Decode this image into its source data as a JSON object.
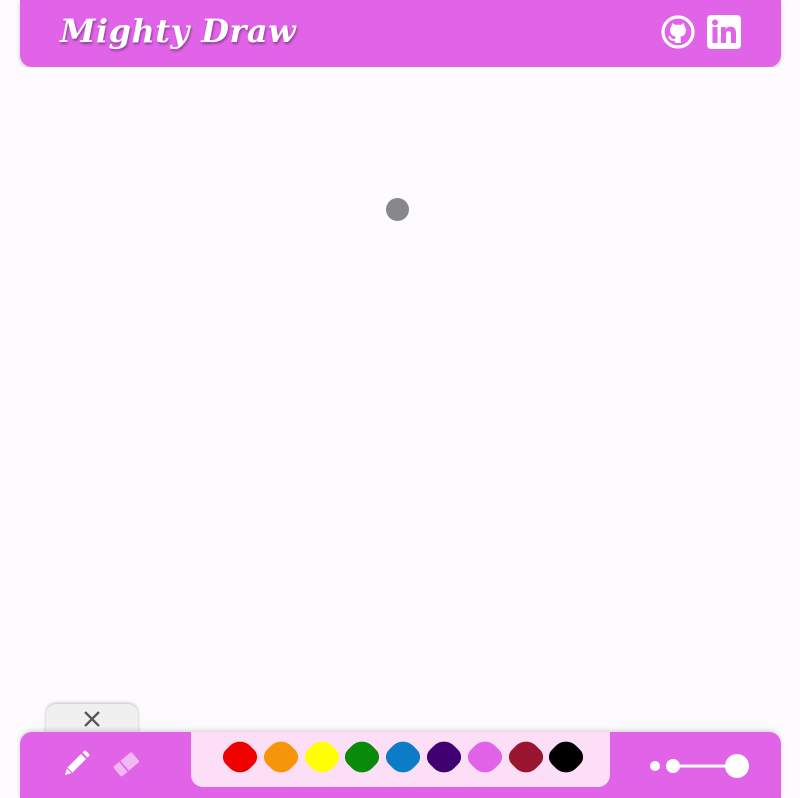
{
  "header": {
    "title": "Mighty Draw",
    "links": [
      {
        "name": "github-icon"
      },
      {
        "name": "linkedin-icon"
      }
    ]
  },
  "tools": [
    {
      "name": "pencil-icon"
    },
    {
      "name": "eraser-icon"
    }
  ],
  "palette": {
    "colors": [
      "#ee0000",
      "#f5950a",
      "#ffff00",
      "#0a8a0a",
      "#0d7cc6",
      "#3f0072",
      "#e063e8",
      "#9a1530",
      "#000000"
    ]
  },
  "brush_size": {
    "icon": "brush-size-slider-icon"
  },
  "close_tab": {
    "icon": "close-icon"
  },
  "cursor": {
    "color": "#888789"
  }
}
